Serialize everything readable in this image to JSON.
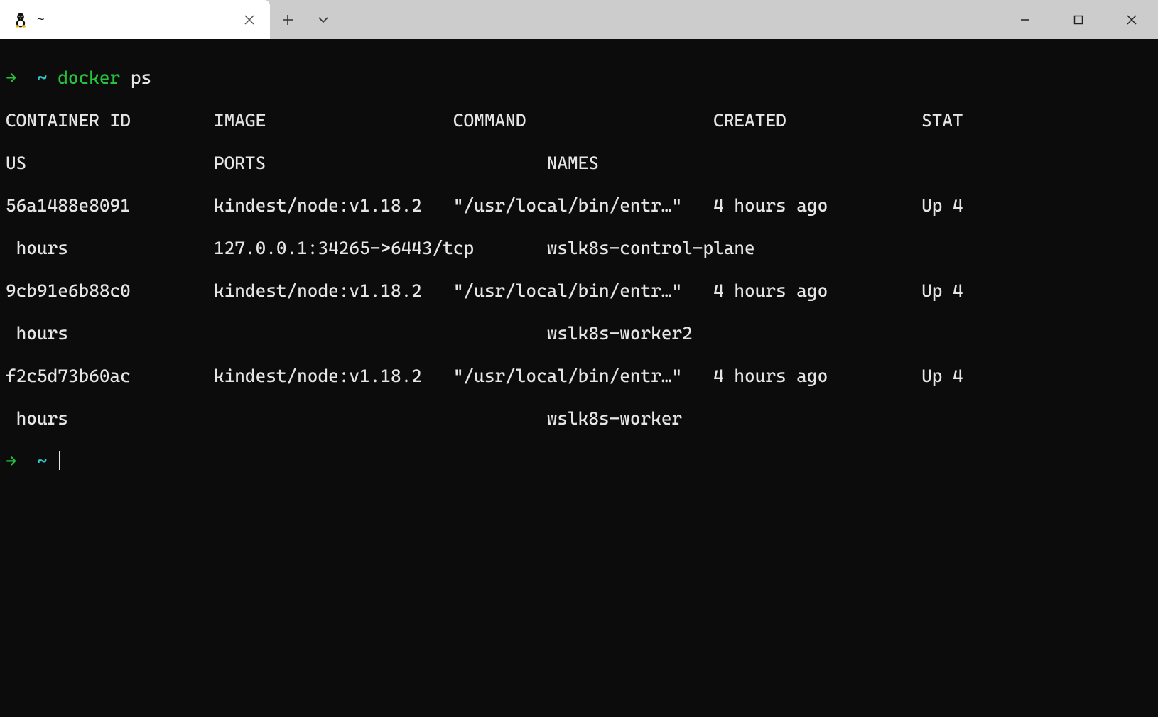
{
  "tab": {
    "title": "~"
  },
  "prompt": {
    "arrow": "→",
    "tilde": "~",
    "command": "docker",
    "args": "ps"
  },
  "output": {
    "header1": "CONTAINER ID        IMAGE                  COMMAND                  CREATED             STAT",
    "header2": "US                  PORTS                           NAMES",
    "r1a": "56a1488e8091        kindest/node:v1.18.2   \"/usr/local/bin/entr…\"   4 hours ago         Up 4",
    "r1b": " hours              127.0.0.1:34265->6443/tcp       wslk8s-control-plane",
    "r2a": "9cb91e6b88c0        kindest/node:v1.18.2   \"/usr/local/bin/entr…\"   4 hours ago         Up 4",
    "r2b": " hours                                              wslk8s-worker2",
    "r3a": "f2c5d73b60ac        kindest/node:v1.18.2   \"/usr/local/bin/entr…\"   4 hours ago         Up 4",
    "r3b": " hours                                              wslk8s-worker"
  }
}
